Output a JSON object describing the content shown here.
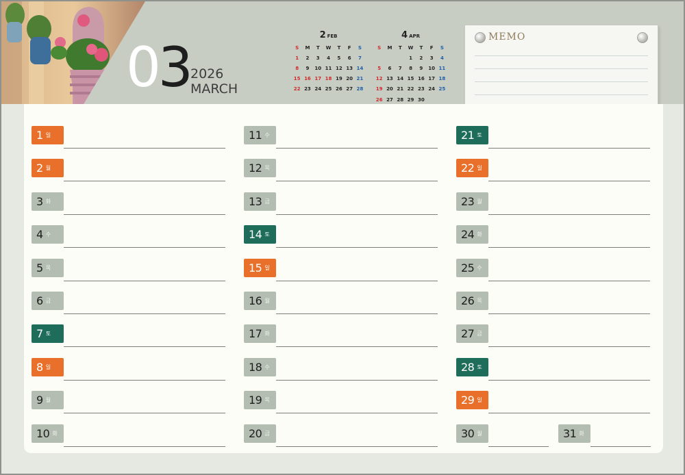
{
  "calendar": {
    "month_number": "03",
    "month_number_first": "0",
    "month_number_second": "3",
    "year": "2026",
    "month_name": "MARCH"
  },
  "mini_calendars": [
    {
      "month": "2",
      "abbr": "FEB",
      "weekday_headers": [
        "S",
        "M",
        "T",
        "W",
        "T",
        "F",
        "S"
      ],
      "weeks": [
        [
          "1",
          "2",
          "3",
          "4",
          "5",
          "6",
          "7"
        ],
        [
          "8",
          "9",
          "10",
          "11",
          "12",
          "13",
          "14"
        ],
        [
          "15",
          "16",
          "17",
          "18",
          "19",
          "20",
          "21"
        ],
        [
          "22",
          "23",
          "24",
          "25",
          "26",
          "27",
          "28"
        ]
      ],
      "red_days": [
        "16",
        "17",
        "18"
      ]
    },
    {
      "month": "4",
      "abbr": "APR",
      "weekday_headers": [
        "S",
        "M",
        "T",
        "W",
        "T",
        "F",
        "S"
      ],
      "weeks": [
        [
          "",
          "",
          "",
          "1",
          "2",
          "3",
          "4"
        ],
        [
          "5",
          "6",
          "7",
          "8",
          "9",
          "10",
          "11"
        ],
        [
          "12",
          "13",
          "14",
          "15",
          "16",
          "17",
          "18"
        ],
        [
          "19",
          "20",
          "21",
          "22",
          "23",
          "24",
          "25"
        ],
        [
          "26",
          "27",
          "28",
          "29",
          "30",
          "",
          ""
        ]
      ],
      "red_days": []
    }
  ],
  "memo": {
    "title": "MEMO"
  },
  "days": [
    {
      "day": "1",
      "weekday": "일",
      "type": "sunday"
    },
    {
      "day": "2",
      "weekday": "월",
      "type": "sunday"
    },
    {
      "day": "3",
      "weekday": "화",
      "type": "weekday"
    },
    {
      "day": "4",
      "weekday": "수",
      "type": "weekday"
    },
    {
      "day": "5",
      "weekday": "목",
      "type": "weekday"
    },
    {
      "day": "6",
      "weekday": "금",
      "type": "weekday"
    },
    {
      "day": "7",
      "weekday": "토",
      "type": "saturday"
    },
    {
      "day": "8",
      "weekday": "일",
      "type": "sunday"
    },
    {
      "day": "9",
      "weekday": "월",
      "type": "weekday"
    },
    {
      "day": "10",
      "weekday": "화",
      "type": "weekday"
    },
    {
      "day": "11",
      "weekday": "수",
      "type": "weekday"
    },
    {
      "day": "12",
      "weekday": "목",
      "type": "weekday"
    },
    {
      "day": "13",
      "weekday": "금",
      "type": "weekday"
    },
    {
      "day": "14",
      "weekday": "토",
      "type": "saturday"
    },
    {
      "day": "15",
      "weekday": "일",
      "type": "sunday"
    },
    {
      "day": "16",
      "weekday": "월",
      "type": "weekday"
    },
    {
      "day": "17",
      "weekday": "화",
      "type": "weekday"
    },
    {
      "day": "18",
      "weekday": "수",
      "type": "weekday"
    },
    {
      "day": "19",
      "weekday": "목",
      "type": "weekday"
    },
    {
      "day": "20",
      "weekday": "금",
      "type": "weekday"
    },
    {
      "day": "21",
      "weekday": "토",
      "type": "saturday"
    },
    {
      "day": "22",
      "weekday": "일",
      "type": "sunday"
    },
    {
      "day": "23",
      "weekday": "월",
      "type": "weekday"
    },
    {
      "day": "24",
      "weekday": "화",
      "type": "weekday"
    },
    {
      "day": "25",
      "weekday": "수",
      "type": "weekday"
    },
    {
      "day": "26",
      "weekday": "목",
      "type": "weekday"
    },
    {
      "day": "27",
      "weekday": "금",
      "type": "weekday"
    },
    {
      "day": "28",
      "weekday": "토",
      "type": "saturday"
    },
    {
      "day": "29",
      "weekday": "일",
      "type": "sunday"
    },
    {
      "day": "30",
      "weekday": "월",
      "type": "weekday"
    },
    {
      "day": "31",
      "weekday": "화",
      "type": "weekday"
    }
  ],
  "colors": {
    "sunday": "#e8702a",
    "saturday": "#1d6d5a",
    "weekday": "#b4bdb2",
    "header_band": "#c8cdc4",
    "mini_sunday": "#d0282a",
    "mini_saturday": "#1f5ea8"
  }
}
